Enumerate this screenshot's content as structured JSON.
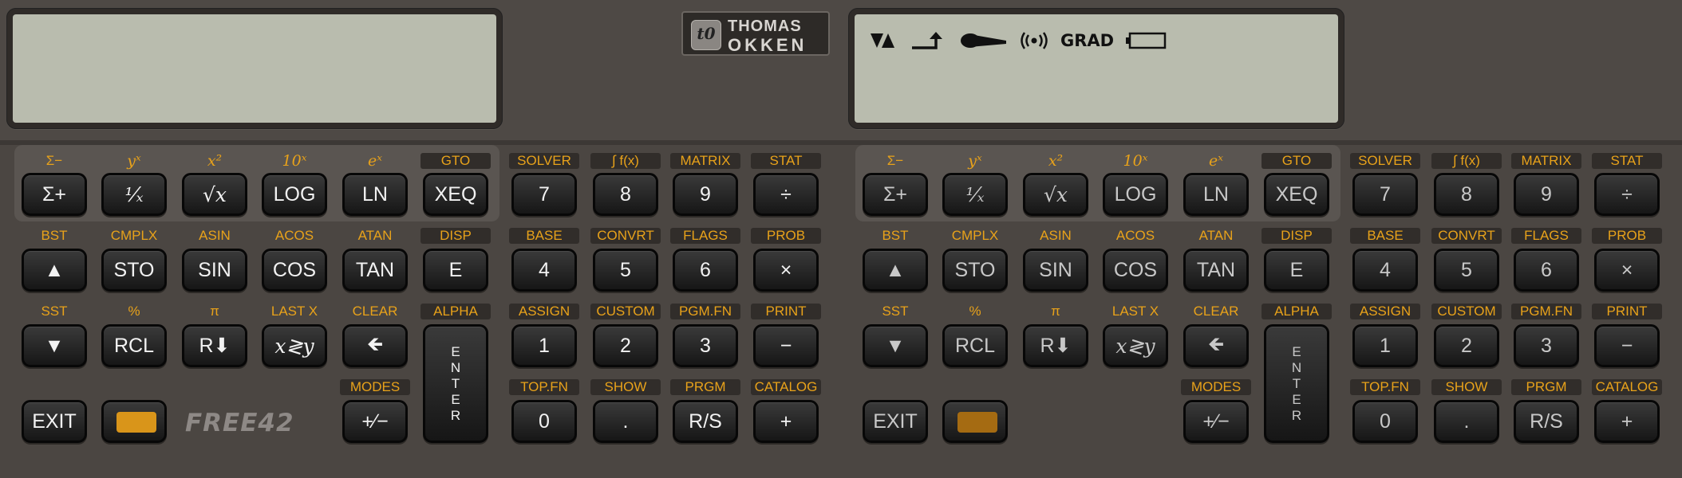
{
  "brand": {
    "logo_mark": "t0",
    "logo_line1": "THOMAS",
    "logo_line2": "OKKEN",
    "product_mark": "FREE42"
  },
  "display_right": {
    "annunciators": {
      "updown_icon": "up-down-triangles",
      "shift_icon": "shift-arrow",
      "print_icon": "printer-nozzle",
      "io_icon": "radio-waves",
      "angle_mode": "GRAD",
      "battery_icon": "battery-low"
    }
  },
  "colors": {
    "shift_label": "#e8a21a",
    "lcd": "#b9bcae",
    "body": "#4b4642",
    "key": "#1f1f1f"
  },
  "keypad": {
    "row1": [
      {
        "shift": "Σ−",
        "label": "Σ+"
      },
      {
        "shift": "yˣ",
        "label": "¹⁄ₓ"
      },
      {
        "shift": "x²",
        "label": "√x"
      },
      {
        "shift": "10ˣ",
        "label": "LOG"
      },
      {
        "shift": "eˣ",
        "label": "LN"
      },
      {
        "shift": "GTO",
        "label": "XEQ"
      },
      {
        "shift": "SOLVER",
        "label": "7"
      },
      {
        "shift": "∫ f(x)",
        "label": "8"
      },
      {
        "shift": "MATRIX",
        "label": "9"
      },
      {
        "shift": "STAT",
        "label": "÷"
      }
    ],
    "row2": [
      {
        "shift": "BST",
        "label": "▲"
      },
      {
        "shift": "CMPLX",
        "label": "STO"
      },
      {
        "shift": "ASIN",
        "label": "SIN"
      },
      {
        "shift": "ACOS",
        "label": "COS"
      },
      {
        "shift": "ATAN",
        "label": "TAN"
      },
      {
        "shift": "DISP",
        "label": "E"
      },
      {
        "shift": "BASE",
        "label": "4"
      },
      {
        "shift": "CONVRT",
        "label": "5"
      },
      {
        "shift": "FLAGS",
        "label": "6"
      },
      {
        "shift": "PROB",
        "label": "×"
      }
    ],
    "row3": [
      {
        "shift": "SST",
        "label": "▼"
      },
      {
        "shift": "%",
        "label": "RCL"
      },
      {
        "shift": "π",
        "label": "R⬇"
      },
      {
        "shift": "LAST X",
        "label": "x≷y"
      },
      {
        "shift": "CLEAR",
        "label": "🡸"
      },
      {
        "shift": "ALPHA",
        "label": "ENTER"
      },
      {
        "shift": "ASSIGN",
        "label": "1"
      },
      {
        "shift": "CUSTOM",
        "label": "2"
      },
      {
        "shift": "PGM.FN",
        "label": "3"
      },
      {
        "shift": "PRINT",
        "label": "−"
      }
    ],
    "row4": [
      {
        "shift": "",
        "label": "EXIT"
      },
      {
        "shift": "",
        "label": ""
      },
      {
        "shift": "MODES",
        "label": "+∕−"
      },
      {
        "shift": "TOP.FN",
        "label": "0"
      },
      {
        "shift": "SHOW",
        "label": "."
      },
      {
        "shift": "PRGM",
        "label": "R/S"
      },
      {
        "shift": "CATALOG",
        "label": "+"
      }
    ]
  }
}
